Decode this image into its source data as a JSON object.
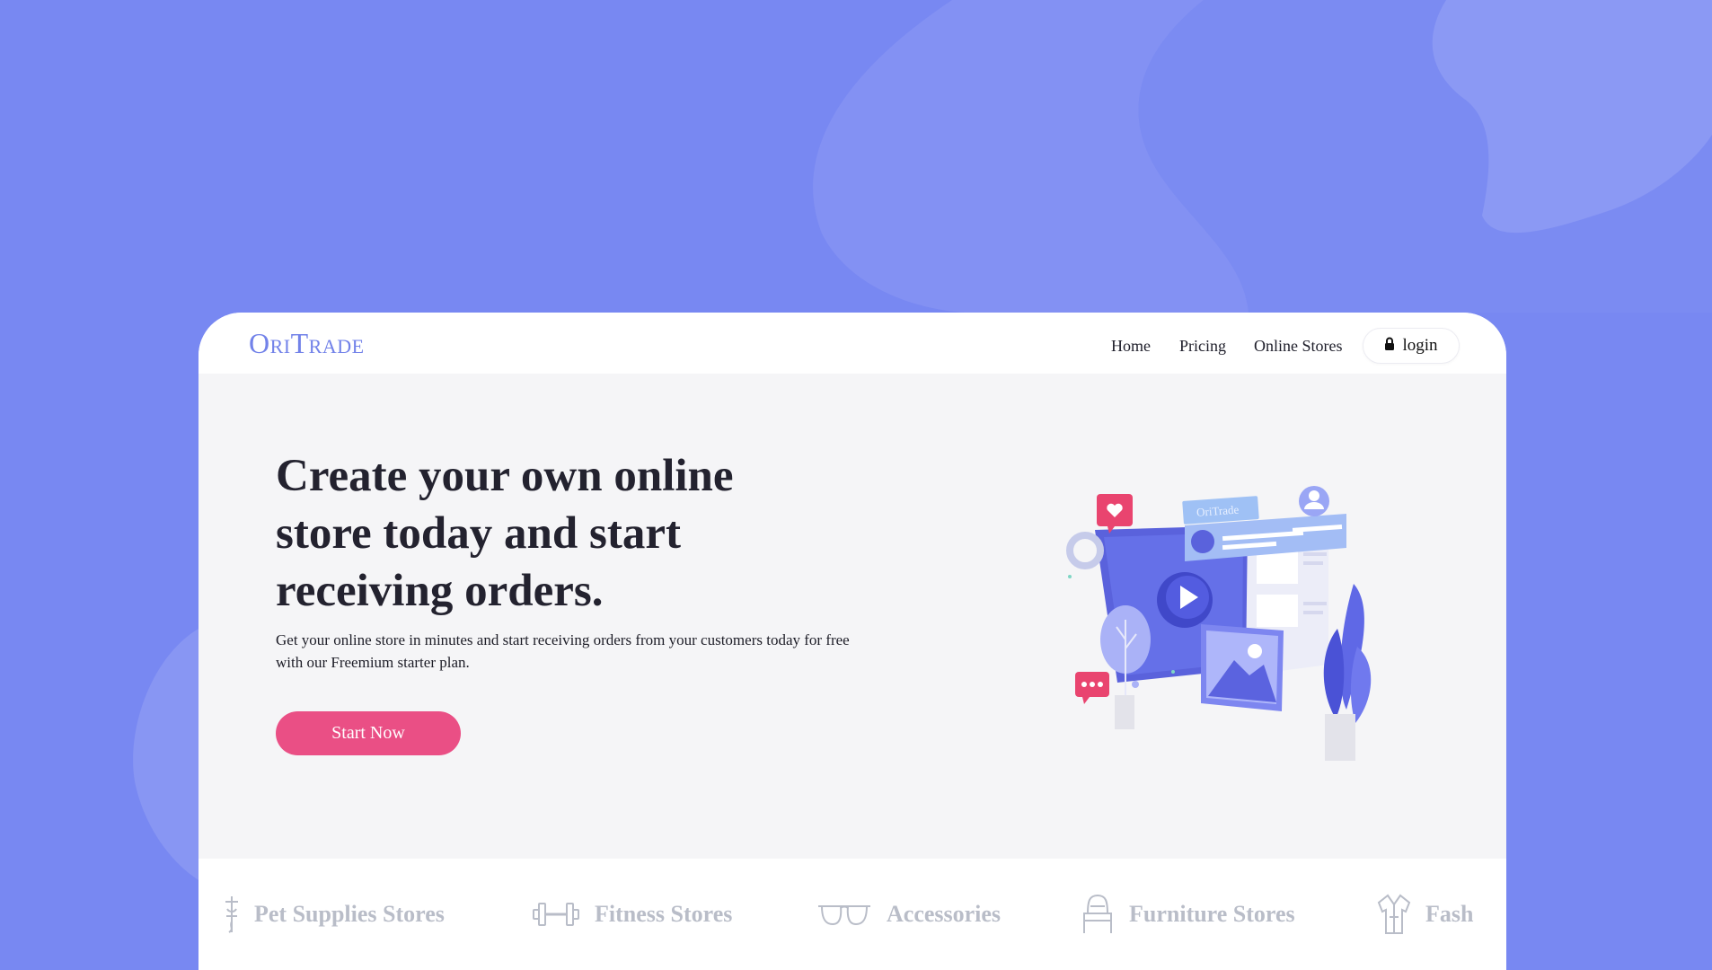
{
  "brand": {
    "logo": "OriTrade"
  },
  "nav": {
    "links": [
      "Home",
      "Pricing",
      "Online Stores"
    ],
    "login_label": "login",
    "login_icon": "lock-icon"
  },
  "hero": {
    "title": "Create your own online store today and start receiving orders.",
    "description": "Get your online store in minutes and start receiving orders from your customers today for free with our Freemium starter plan.",
    "cta_label": "Start Now",
    "illustration_badge": "OriTrade"
  },
  "categories": [
    {
      "label": "Pet Supplies Stores",
      "icon": "pet-icon"
    },
    {
      "label": "Fitness Stores",
      "icon": "dumbbell-icon"
    },
    {
      "label": "Accessories",
      "icon": "glasses-icon"
    },
    {
      "label": "Furniture Stores",
      "icon": "chair-icon"
    },
    {
      "label": "Fash",
      "icon": "clothing-icon"
    }
  ],
  "colors": {
    "background": "#7888f2",
    "brand": "#7282e9",
    "accent": "#ea4f85",
    "category_text": "#b9bdc8"
  }
}
